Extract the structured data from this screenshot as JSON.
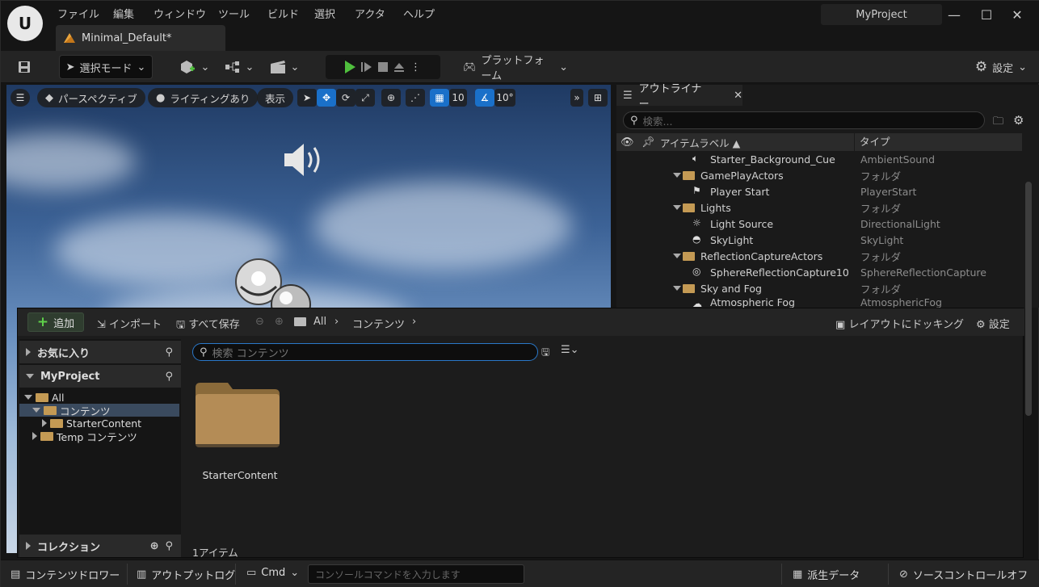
{
  "menu": [
    "ファイル",
    "編集",
    "ウィンドウ",
    "ツール",
    "ビルド",
    "選択",
    "アクタ",
    "ヘルプ"
  ],
  "document_tab": "Minimal_Default*",
  "project_name": "MyProject",
  "window_controls": {
    "minimize": "—",
    "maximize": "☐",
    "close": "✕"
  },
  "toolbar": {
    "mode_label": "選択モード",
    "platform_label": "プラットフォーム",
    "settings_label": "設定"
  },
  "viewport": {
    "perspective": "パースペクティブ",
    "lighting": "ライティングあり",
    "show": "表示",
    "grid_snap": "10",
    "rotate_snap": "10°"
  },
  "outliner": {
    "tab": "アウトライナー",
    "search_placeholder": "検索...",
    "col_label": "アイテムラベル ▲",
    "col_type": "タイプ",
    "rows": [
      {
        "label": "Starter_Background_Cue",
        "type": "AmbientSound",
        "icon": "speaker-icon"
      },
      {
        "label": "GamePlayActors",
        "type": "フォルダ",
        "icon": "folder-icon"
      },
      {
        "label": "Player Start",
        "type": "PlayerStart",
        "icon": "flag-icon"
      },
      {
        "label": "Lights",
        "type": "フォルダ",
        "icon": "folder-icon"
      },
      {
        "label": "Light Source",
        "type": "DirectionalLight",
        "icon": "sun-icon"
      },
      {
        "label": "SkyLight",
        "type": "SkyLight",
        "icon": "skylight-icon"
      },
      {
        "label": "ReflectionCaptureActors",
        "type": "フォルダ",
        "icon": "folder-icon"
      },
      {
        "label": "SphereReflectionCapture10",
        "type": "SphereReflectionCapture",
        "icon": "sphere-icon"
      },
      {
        "label": "Sky and Fog",
        "type": "フォルダ",
        "icon": "folder-icon"
      },
      {
        "label": "Atmospheric Fog",
        "type": "AtmosphericFog",
        "icon": "fog-icon"
      }
    ]
  },
  "content_browser": {
    "add": "追加",
    "import": "インポート",
    "save_all": "すべて保存",
    "breadcrumb": [
      "All",
      "コンテンツ"
    ],
    "dock_layout": "レイアウトにドッキング",
    "settings": "設定",
    "favorites": "お気に入り",
    "project": "MyProject",
    "tree": [
      "All",
      "コンテンツ",
      "StarterContent",
      "Temp コンテンツ"
    ],
    "collections": "コレクション",
    "search_placeholder": "検索 コンテンツ",
    "folder_name": "StarterContent",
    "item_count": "1アイテム"
  },
  "statusbar": {
    "content_drawer": "コンテンツドロワー",
    "output_log": "アウトプットログ",
    "cmd": "Cmd",
    "console_placeholder": "コンソールコマンドを入力します",
    "derived_data": "派生データ",
    "source_control": "ソースコントロールオフ"
  }
}
